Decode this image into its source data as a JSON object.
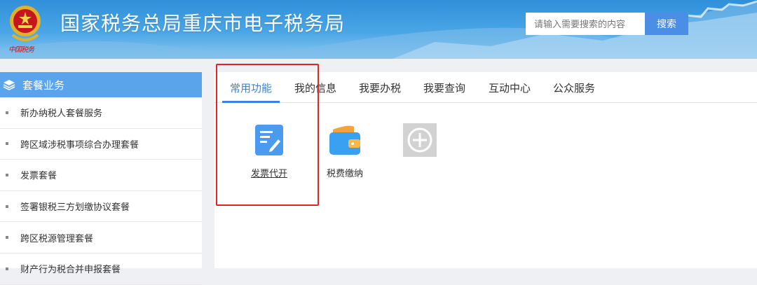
{
  "header": {
    "site_title": "国家税务总局重庆市电子税务局",
    "emblem_script": "中国税务",
    "search_placeholder": "请输入需要搜索的内容",
    "search_button": "搜索"
  },
  "sidebar": {
    "title": "套餐业务",
    "items": [
      "新办纳税人套餐服务",
      "跨区域涉税事项综合办理套餐",
      "发票套餐",
      "签署银税三方划缴协议套餐",
      "跨区税源管理套餐",
      "财产行为税合并申报套餐"
    ]
  },
  "tabs": [
    {
      "label": "常用功能",
      "active": true
    },
    {
      "label": "我的信息",
      "active": false
    },
    {
      "label": "我要办税",
      "active": false
    },
    {
      "label": "我要查询",
      "active": false
    },
    {
      "label": "互动中心",
      "active": false
    },
    {
      "label": "公众服务",
      "active": false
    }
  ],
  "functions": [
    {
      "label": "发票代开",
      "icon": "invoice-edit-icon",
      "color": "#4a9bf0"
    },
    {
      "label": "税费缴纳",
      "icon": "wallet-icon",
      "color": "#3aa0f2"
    },
    {
      "label": "",
      "icon": "add-icon",
      "color": "#d2d2d2"
    }
  ],
  "colors": {
    "accent": "#3a84e0",
    "sidebar_header": "#5aa4ec",
    "highlight_frame": "#e32424"
  }
}
